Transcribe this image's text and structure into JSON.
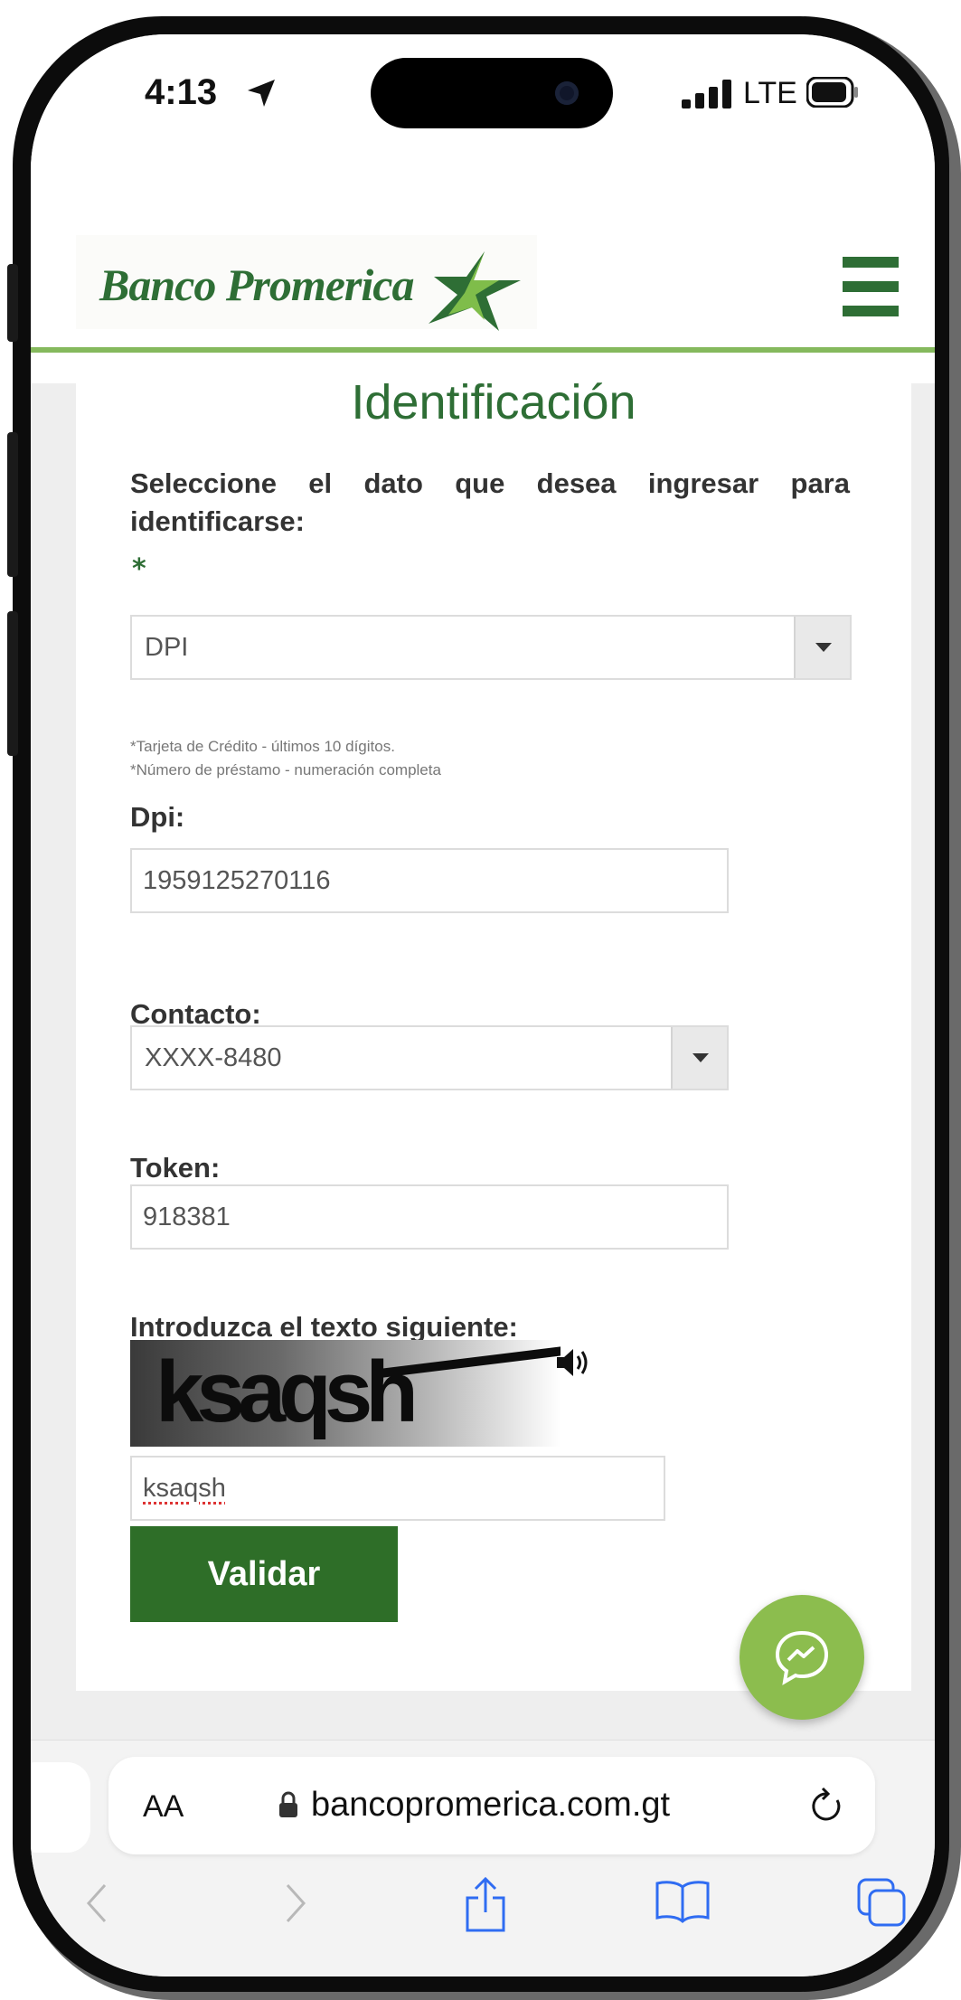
{
  "status_bar": {
    "time": "4:13",
    "network": "LTE"
  },
  "header": {
    "brand": "Banco Promerica"
  },
  "page": {
    "title": "Identificación",
    "prompt": "Seleccione el dato que desea ingresar para identificarse:",
    "required_mark": "*",
    "id_type": {
      "selected": "DPI"
    },
    "notes": [
      "*Tarjeta de Crédito - últimos 10 dígitos.",
      "*Número de préstamo - numeración completa"
    ],
    "dpi": {
      "label": "Dpi:",
      "value": "1959125270116"
    },
    "contacto": {
      "label": "Contacto:",
      "selected": "XXXX-8480"
    },
    "token": {
      "label": "Token:",
      "value": "918381"
    },
    "captcha": {
      "label": "Introduzca el texto siguiente:",
      "image_text": "ksaqsh",
      "value": "ksaqsh"
    },
    "submit_label": "Validar"
  },
  "browser": {
    "text_size_label": "AA",
    "url": "bancopromerica.com.gt"
  },
  "colors": {
    "brand_green": "#2e6e35",
    "accent_light_green": "#85b95d",
    "button_green": "#2e6e28",
    "chat_green": "#8cbd4e"
  },
  "icons": [
    "location-arrow-icon",
    "cellular-signal-icon",
    "battery-icon",
    "promerica-star-logo",
    "hamburger-menu-icon",
    "dropdown-arrow-icon",
    "speaker-icon",
    "messenger-chat-icon",
    "lock-icon",
    "reload-icon",
    "back-icon",
    "forward-icon",
    "share-icon",
    "bookmarks-icon",
    "tabs-icon"
  ]
}
